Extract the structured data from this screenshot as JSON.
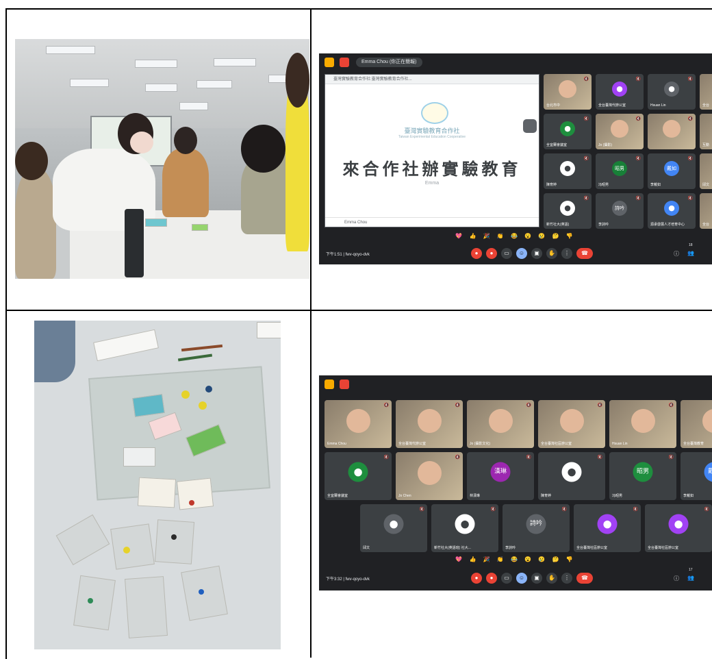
{
  "meet1": {
    "presenter": "Emma Chou (你正在簡報)",
    "url": "臺灣實驗教育合作社:臺灣實驗教育合作社...",
    "slide": {
      "org": "臺灣實驗教育合作社",
      "org_en": "Taiwan Experimental Education Cooperative",
      "title": "來合作社辦實驗教育",
      "author": "Emma",
      "bottom": "Emma Chou"
    },
    "tiles": [
      {
        "name": "台北市中",
        "type": "video"
      },
      {
        "name": "全台臺灣代辦公室",
        "type": "avatar",
        "color": "#a142f4",
        "letter": "●"
      },
      {
        "name": "Hsuan Lin",
        "type": "avatar",
        "color": "#5f6368",
        "letter": "●"
      },
      {
        "name": "全台",
        "type": "video"
      },
      {
        "name": "全宜蘭會議室",
        "type": "avatar",
        "color": "#1e8e3e",
        "letter": "●"
      },
      {
        "name": "Jo (攝影)",
        "type": "video"
      },
      {
        "name": "",
        "type": "video"
      },
      {
        "name": "互動",
        "type": "video"
      },
      {
        "name": "陳育婷",
        "type": "avatar",
        "color": "#ffffff",
        "letter": "●"
      },
      {
        "name": "冯昭男",
        "type": "avatar",
        "color": "#188038",
        "letter": "昭男"
      },
      {
        "name": "李戴如",
        "type": "avatar",
        "color": "#4285f4",
        "letter": "戴如"
      },
      {
        "name": "邱文",
        "type": "video"
      },
      {
        "name": "新竹社大(英語)",
        "type": "avatar",
        "color": "#ffffff",
        "letter": "●"
      },
      {
        "name": "李詩吟",
        "type": "avatar",
        "color": "#5f6368",
        "letter": "詩吟"
      },
      {
        "name": "源承發展人才培育中心",
        "type": "avatar",
        "color": "#4285f4",
        "letter": "●"
      },
      {
        "name": "全台",
        "type": "video"
      }
    ],
    "emojis": "💖 👍 🎉 👏 😂 😮 😢 🤔 👎",
    "time": "下午1:51  |  fwv-qoyo-dvk",
    "count": "18"
  },
  "meet2": {
    "row1": [
      "Emma Chou",
      "全台臺灣代辦公室",
      "Jo (攝影文化)",
      "全台臺灣社區辦公室",
      "Hsuan Lin",
      "全台臺灣教育"
    ],
    "row2": [
      {
        "name": "全宜蘭會議室",
        "type": "avatar",
        "color": "#1e8e3e",
        "letter": "●"
      },
      {
        "name": "Jo Chen",
        "type": "video"
      },
      {
        "name": "林漢琳",
        "type": "avatar",
        "color": "#9c27b0",
        "letter": "漢琳"
      },
      {
        "name": "陳育婷",
        "type": "avatar",
        "color": "#ffffff",
        "letter": "●"
      },
      {
        "name": "冯昭男",
        "type": "avatar",
        "color": "#1e8e3e",
        "letter": "昭男"
      },
      {
        "name": "李戴如",
        "type": "avatar",
        "color": "#4285f4",
        "letter": "戴如"
      }
    ],
    "row3": [
      {
        "name": "邱文",
        "type": "avatar",
        "color": "#5f6368",
        "letter": "●"
      },
      {
        "name": "新竹社大(英語班) 社大...",
        "type": "avatar",
        "color": "#ffffff",
        "letter": "●"
      },
      {
        "name": "李詩吟",
        "type": "avatar",
        "color": "#5f6368",
        "letter": "詩吟"
      },
      {
        "name": "全台臺灣社區辦公室",
        "type": "avatar",
        "color": "#a142f4",
        "letter": "●"
      },
      {
        "name": "全台臺灣社區辦公室",
        "type": "avatar",
        "color": "#a142f4",
        "letter": "●"
      }
    ],
    "emojis": "💖 👍 🎉 👏 😂 😮 😢 🤔 👎",
    "time": "下午3:32  |  fwv-qoyo-dvk",
    "count": "17"
  }
}
